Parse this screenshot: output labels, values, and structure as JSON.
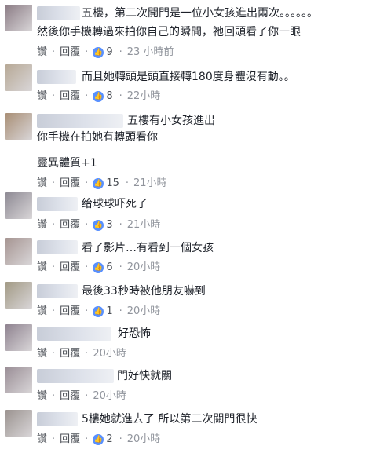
{
  "labels": {
    "like": "讚",
    "reply": "回覆"
  },
  "comments": [
    {
      "lines": [
        "五樓，第二次開門是一位小女孩進出兩次。。。。。。",
        "然後你手機轉過來拍你自己的瞬間，祂回頭看了你一眼"
      ],
      "likes": "9",
      "time": "23 小時前",
      "avatar": "#8c7d86"
    },
    {
      "lines": [
        "而且她轉頭是頭直接轉180度身體沒有動。。"
      ],
      "likes": "8",
      "time": "22小時",
      "avatar": "#b7a996"
    },
    {
      "lines": [
        "五樓有小女孩進出",
        "你手機在拍她有轉頭看你",
        "",
        "靈異體質+1"
      ],
      "likes": "15",
      "time": "21小時",
      "avatar": "#a98f76"
    },
    {
      "lines": [
        "给球球吓死了"
      ],
      "likes": "3",
      "time": "21小時",
      "avatar": "#8e8a94"
    },
    {
      "lines": [
        "看了影片…有看到一個女孩"
      ],
      "likes": "6",
      "time": "20小時",
      "avatar": "#a69592"
    },
    {
      "lines": [
        "最後33秒時被他朋友嚇到"
      ],
      "likes": "1",
      "time": "20小時",
      "avatar": "#a29a85"
    },
    {
      "lines": [
        "好恐怖"
      ],
      "likes": "",
      "time": "20小時",
      "avatar": "#8f8390"
    },
    {
      "lines": [
        "門好快就關"
      ],
      "likes": "",
      "time": "20小時",
      "avatar": "#9a8e96"
    },
    {
      "lines": [
        "5樓她就進去了 所以第二次關門很快"
      ],
      "likes": "2",
      "time": "20小時",
      "avatar": "#9b9390"
    }
  ]
}
